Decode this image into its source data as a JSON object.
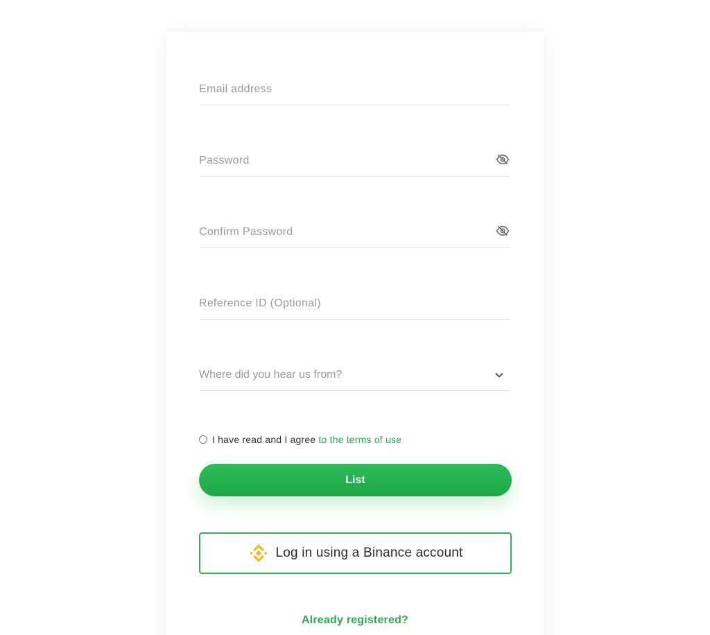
{
  "form": {
    "email": {
      "placeholder": "Email address",
      "value": ""
    },
    "password": {
      "placeholder": "Password",
      "value": ""
    },
    "confirm_password": {
      "placeholder": "Confirm Password",
      "value": ""
    },
    "reference_id": {
      "placeholder": "Reference ID (Optional)",
      "value": ""
    },
    "source_select": {
      "selected": "Where did you hear us from?"
    },
    "terms": {
      "text": "I have read and I agree",
      "link": "to the terms of use",
      "checked": false
    },
    "submit_label": "List",
    "binance_label": "Log in using a Binance account",
    "already_registered": "Already registered?"
  },
  "icons": {
    "password_toggle": "eye-slash-icon",
    "select_arrow": "chevron-down-icon",
    "binance": "binance-logo-icon"
  },
  "colors": {
    "accent": "#2fa84f",
    "button": "#22ad4d",
    "binance": "#f3ba2f"
  }
}
